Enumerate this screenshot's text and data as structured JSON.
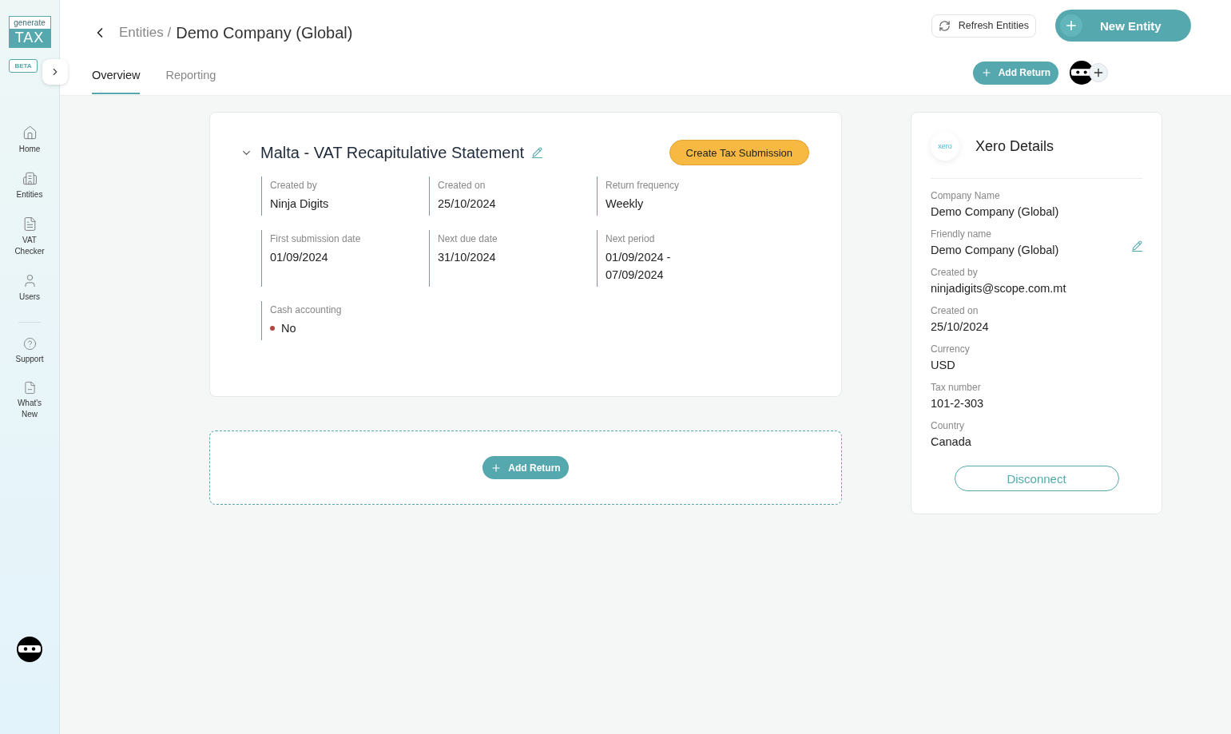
{
  "sidebar": {
    "logo": {
      "top": "generate",
      "bottom": "TAX"
    },
    "badge": "BETA",
    "items": [
      {
        "label": "Home"
      },
      {
        "label": "Entities"
      },
      {
        "label": "VAT Checker"
      },
      {
        "label": "Users"
      }
    ],
    "bottom_items": [
      {
        "label": "Support"
      },
      {
        "label": "What's New"
      }
    ]
  },
  "header": {
    "breadcrumb": {
      "parent": "Entities /",
      "current": "Demo Company (Global)"
    },
    "tabs": [
      {
        "label": "Overview",
        "selected": true
      },
      {
        "label": "Reporting",
        "selected": false
      }
    ],
    "refresh_button": "Refresh Entities",
    "new_button": "New Entity",
    "add_return_button": "Add Return"
  },
  "return_card": {
    "title": "Malta - VAT Recapitulative Statement",
    "action": "Create Tax Submission",
    "expanded": true,
    "fields": [
      {
        "label": "Created by",
        "value": "Ninja Digits"
      },
      {
        "label": "Created on",
        "value": "25/10/2024"
      },
      {
        "label": "Return frequency",
        "value": "Weekly"
      },
      {
        "label": "First submission date",
        "value": "01/09/2024"
      },
      {
        "label": "Next due date",
        "value": "31/10/2024"
      },
      {
        "label": "Next period",
        "value": "01/09/2024 - 07/09/2024"
      },
      {
        "label": "Cash accounting",
        "value": "No",
        "color": "#b5453d"
      }
    ]
  },
  "add_return_panel": {
    "button": "Add Return"
  },
  "xero_card": {
    "logo": "xero",
    "title": "Xero Details",
    "fields": [
      {
        "label": "Company Name",
        "value": "Demo Company (Global)",
        "editable": false
      },
      {
        "label": "Friendly name",
        "value": "Demo Company (Global)",
        "editable": true
      },
      {
        "label": "Created by",
        "value": "ninjadigits@scope.com.mt",
        "editable": false
      },
      {
        "label": "Created on",
        "value": "25/10/2024",
        "editable": false
      },
      {
        "label": "Currency",
        "value": "USD",
        "editable": false
      },
      {
        "label": "Tax number",
        "value": "101-2-303",
        "editable": false
      },
      {
        "label": "Country",
        "value": "Canada",
        "editable": false
      }
    ],
    "button": "Disconnect"
  }
}
